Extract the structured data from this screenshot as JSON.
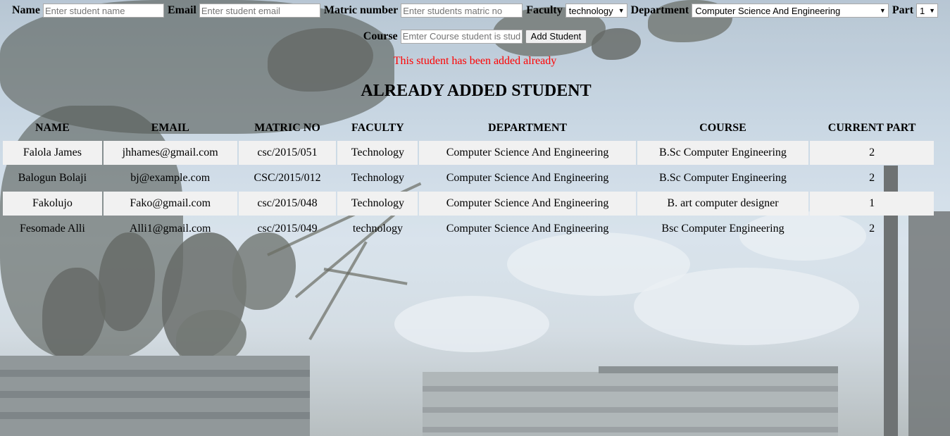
{
  "form": {
    "name_label": "Name",
    "name_placeholder": "Enter student name",
    "email_label": "Email",
    "email_placeholder": "Enter student email",
    "matric_label": "Matric number",
    "matric_placeholder": "Enter students matric no",
    "faculty_label": "Faculty",
    "faculty_selected": "technology",
    "department_label": "Department",
    "department_selected": "Computer Science And Engineering",
    "part_label": "Part",
    "part_selected": "1",
    "course_label": "Course",
    "course_placeholder": "Emter Course student is studying",
    "submit_label": "Add Student"
  },
  "message": {
    "error": "This student has been added already"
  },
  "section": {
    "title": "ALREADY ADDED STUDENT"
  },
  "table": {
    "headers": [
      "NAME",
      "EMAIL",
      "MATRIC NO",
      "FACULTY",
      "DEPARTMENT",
      "COURSE",
      "CURRENT PART"
    ],
    "rows": [
      [
        "Falola James",
        "jhhames@gmail.com",
        "csc/2015/051",
        "Technology",
        "Computer Science And Engineering",
        "B.Sc Computer Engineering",
        "2"
      ],
      [
        "Balogun Bolaji",
        "bj@example.com",
        "CSC/2015/012",
        "Technology",
        "Computer Science And Engineering",
        "B.Sc Computer Engineering",
        "2"
      ],
      [
        "Fakolujo",
        "Fako@gmail.com",
        "csc/2015/048",
        "Technology",
        "Computer Science And Engineering",
        "B. art computer designer",
        "1"
      ],
      [
        "Fesomade Alli",
        "Alli1@gmail.com",
        "csc/2015/049",
        "technology",
        "Computer Science And Engineering",
        "Bsc Computer Engineering",
        "2"
      ]
    ]
  },
  "icons": {
    "dropdown": "chevron-down-icon"
  },
  "colors": {
    "error": "#ff0000",
    "row_shade": "#f1f1f1"
  }
}
